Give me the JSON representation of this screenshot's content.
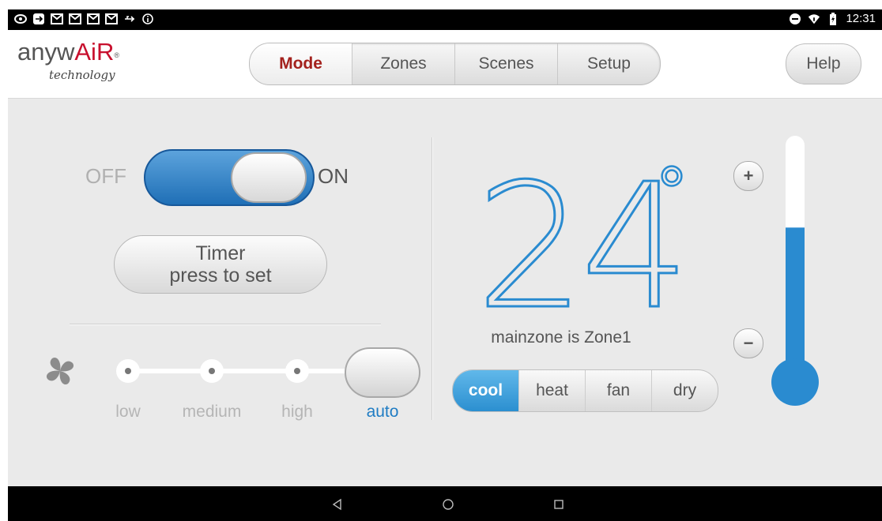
{
  "status_bar": {
    "left_icons": [
      "eye-icon",
      "sync-icon",
      "gmail-icon",
      "gmail-icon",
      "gmail-icon",
      "gmail-icon",
      "usb-icon",
      "info-icon"
    ],
    "right_icons": [
      "do-not-disturb-icon",
      "wifi-icon",
      "battery-charging-icon"
    ],
    "time": "12:31"
  },
  "header": {
    "logo": {
      "prefix": "anyw",
      "accent": "AiR",
      "reg": "®",
      "subtitle": "technology"
    },
    "tabs": [
      {
        "label": "Mode",
        "active": true
      },
      {
        "label": "Zones",
        "active": false
      },
      {
        "label": "Scenes",
        "active": false
      },
      {
        "label": "Setup",
        "active": false
      }
    ],
    "help_label": "Help"
  },
  "power": {
    "off_label": "OFF",
    "on_label": "ON",
    "state": "on"
  },
  "timer": {
    "line1": "Timer",
    "line2": "press to set"
  },
  "fan": {
    "icon": "fan-icon",
    "speeds": [
      {
        "label": "low",
        "active": false
      },
      {
        "label": "medium",
        "active": false
      },
      {
        "label": "high",
        "active": false
      },
      {
        "label": "auto",
        "active": true
      }
    ]
  },
  "temperature": {
    "value": "24",
    "unit": "°",
    "zone_text": "mainzone is Zone1",
    "level": 0.62
  },
  "modes": [
    {
      "label": "cool",
      "active": true
    },
    {
      "label": "heat",
      "active": false
    },
    {
      "label": "fan",
      "active": false
    },
    {
      "label": "dry",
      "active": false
    }
  ],
  "controls": {
    "increase_symbol": "+",
    "decrease_symbol": "−"
  },
  "nav": {
    "icons": [
      "back-icon",
      "home-icon",
      "recents-icon"
    ]
  },
  "colors": {
    "accent_blue": "#2a8bd0",
    "brand_red": "#c8102e",
    "active_tab": "#a3211d",
    "background": "#eaeaea"
  }
}
